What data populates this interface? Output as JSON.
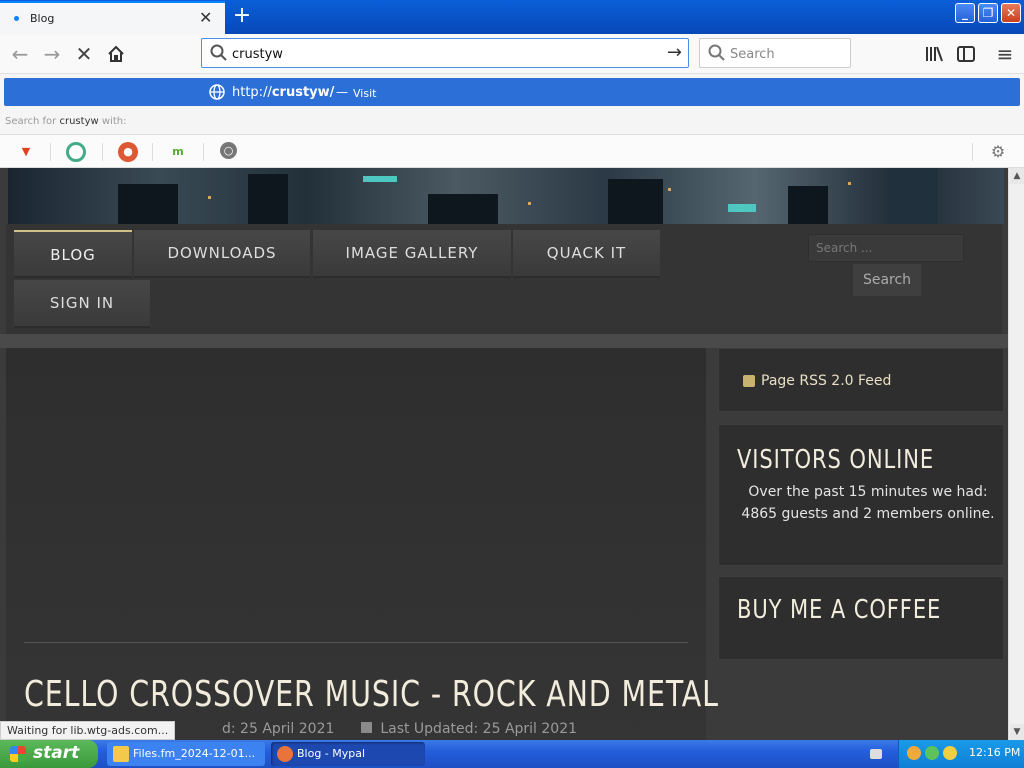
{
  "browser": {
    "tab": {
      "title": "Blog",
      "close": "✕"
    },
    "new_tab": "+",
    "window_buttons": {
      "minimize": "_",
      "restore": "❐",
      "close": "✕"
    },
    "url_input": "crustyw",
    "search_placeholder": "Search",
    "dropdown": {
      "url_prefix": "http://",
      "url_host": "crustyw/",
      "dash": "—",
      "visit": "Visit",
      "search_for_prefix": "Search for",
      "search_for_query": "crustyw",
      "search_for_suffix": "with:"
    }
  },
  "site": {
    "nav": [
      {
        "label": "BLOG"
      },
      {
        "label": "DOWNLOADS"
      },
      {
        "label": "IMAGE GALLERY"
      },
      {
        "label": "QUACK IT"
      },
      {
        "label": "SIGN IN"
      }
    ],
    "search_placeholder": "Search ...",
    "search_button": "Search",
    "article": {
      "title": "CELLO CROSSOVER MUSIC - ROCK AND METAL",
      "published_fragment": "d: 25 April 2021",
      "last_updated": "Last Updated: 25 April 2021"
    },
    "widgets": {
      "rss": "Page RSS 2.0 Feed",
      "visitors_title": "VISITORS ONLINE",
      "visitors_body": "Over the past 15 minutes we had: 4865 guests and 2 members online.",
      "coffee_title": "BUY ME A COFFEE"
    }
  },
  "status_text": "Waiting for lib.wtg-ads.com...",
  "taskbar": {
    "start": "start",
    "tasks": [
      {
        "label": "Files.fm_2024-12-01..."
      },
      {
        "label": "Blog - Mypal"
      }
    ],
    "clock": "12:16 PM"
  },
  "colors": {
    "accent": "#2c6fd6",
    "taskbar": "#245edb",
    "start": "#3a9a3a",
    "site_text": "#f2ecdc"
  }
}
